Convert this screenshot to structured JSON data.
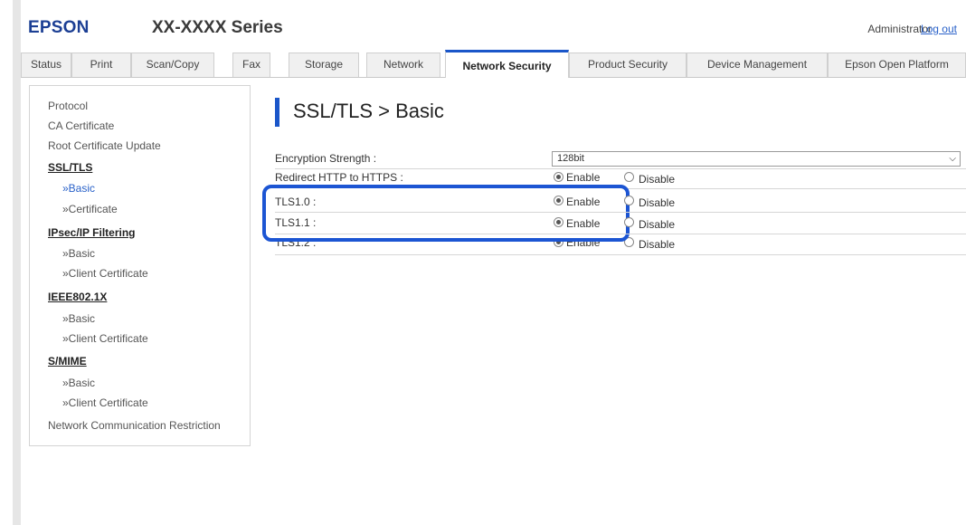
{
  "header": {
    "logo": "EPSON",
    "series": "XX-XXXX Series",
    "user": "Administrator",
    "logout": "Log out"
  },
  "tabs": [
    {
      "label": "Status"
    },
    {
      "label": "Print"
    },
    {
      "label": "Scan/Copy"
    },
    {
      "label": "Fax"
    },
    {
      "label": "Storage"
    },
    {
      "label": "Network"
    },
    {
      "label": "Network Security",
      "active": true
    },
    {
      "label": "Product Security"
    },
    {
      "label": "Device Management"
    },
    {
      "label": "Epson Open Platform"
    }
  ],
  "sidebar": {
    "protocol": "Protocol",
    "ca_certificate": "CA Certificate",
    "root_update": "Root Certificate Update",
    "ssl_tls": "SSL/TLS",
    "ssl_basic": "»Basic",
    "ssl_certificate": "»Certificate",
    "ipsec": "IPsec/IP Filtering",
    "ipsec_basic": "»Basic",
    "ipsec_client": "»Client Certificate",
    "ieee": "IEEE802.1X",
    "ieee_basic": "»Basic",
    "ieee_client": "»Client Certificate",
    "smime": "S/MIME",
    "smime_basic": "»Basic",
    "smime_client": "»Client Certificate",
    "restriction": "Network Communication Restriction"
  },
  "main": {
    "title": "SSL/TLS > Basic",
    "encryption_label": "Encryption Strength :",
    "encryption_value": "128bit",
    "redirect_label": "Redirect HTTP to HTTPS :",
    "tls10_label": "TLS1.0 :",
    "tls11_label": "TLS1.1 :",
    "tls12_label": "TLS1.2 :",
    "enable": "Enable",
    "disable": "Disable"
  },
  "colors": {
    "brand": "#1c3f94",
    "accent": "#1a56c9",
    "highlight": "#1c55d3",
    "link": "#2a62c9"
  }
}
